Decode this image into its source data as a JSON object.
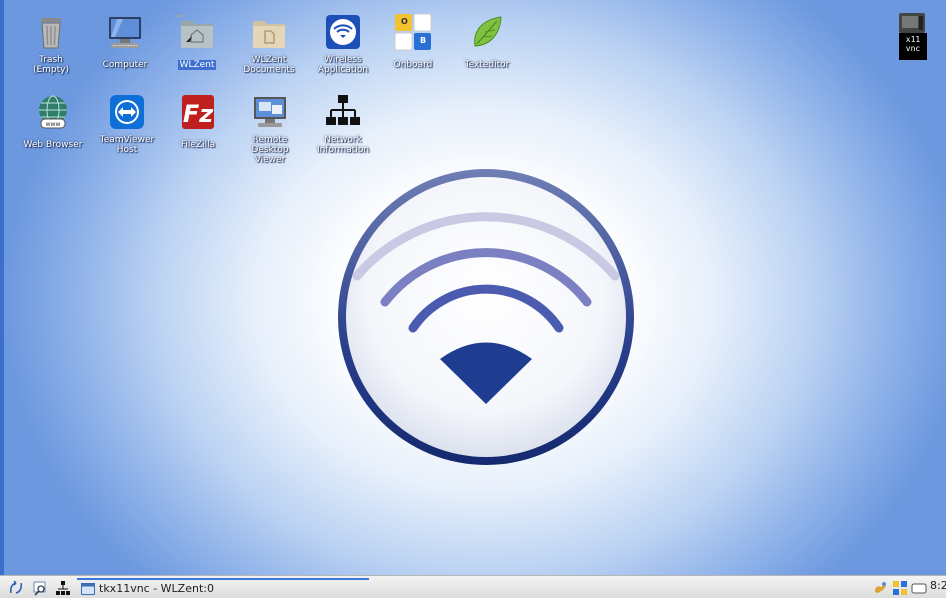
{
  "desktop": {
    "icons": [
      {
        "label": "Trash\n(Empty)"
      },
      {
        "label": "Computer"
      },
      {
        "label": "WLZent"
      },
      {
        "label": "WLZent\nDocuments"
      },
      {
        "label": "Wireless\nApplication"
      },
      {
        "label": "Onboard"
      },
      {
        "label": "Texteditor"
      },
      {
        "label": "Web Browser"
      },
      {
        "label": "TeamViewer\nHost"
      },
      {
        "label": "FileZilla"
      },
      {
        "label": "Remote\nDesktop\nViewer"
      },
      {
        "label": "Network\nInformation"
      }
    ],
    "onboard_keys": [
      "O",
      "B"
    ],
    "x11vnc_label": "x11\nvnc"
  },
  "taskbar": {
    "task_title": "tkx11vnc - WLZent:0",
    "clock": "8:2"
  },
  "colors": {
    "desktop_blue": "#6c98df",
    "logo_navy": "#1f3a8a",
    "selection": "#3f6fd1"
  }
}
